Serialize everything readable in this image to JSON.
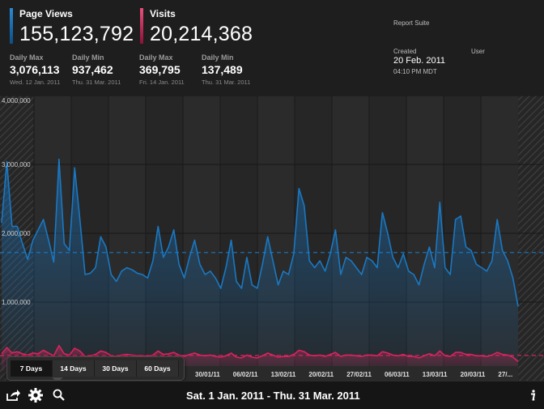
{
  "header": {
    "page_views": {
      "label": "Page Views",
      "value": "155,123,792",
      "color": "#1a78c2"
    },
    "visits": {
      "label": "Visits",
      "value": "20,214,368",
      "color": "#d8245e"
    },
    "pv_daily_max": {
      "label": "Daily Max",
      "value": "3,076,113",
      "date": "Wed. 12 Jan. 2011"
    },
    "pv_daily_min": {
      "label": "Daily Min",
      "value": "937,462",
      "date": "Thu. 31 Mar. 2011"
    },
    "v_daily_max": {
      "label": "Daily Max",
      "value": "369,795",
      "date": "Fri. 14 Jan. 2011"
    },
    "v_daily_min": {
      "label": "Daily Min",
      "value": "137,489",
      "date": "Thu. 31 Mar. 2011"
    },
    "report_suite_label": "Report Suite",
    "created_label": "Created",
    "created_date": "20 Feb. 2011",
    "created_time": "04:10 PM MDT",
    "user_label": "User"
  },
  "range_picker": {
    "options": [
      "7 Days",
      "14 Days",
      "30 Days",
      "60 Days"
    ],
    "selected": "7 Days"
  },
  "footer": {
    "date_range": "Sat.  1 Jan. 2011   -   Thu. 31 Mar. 2011"
  },
  "chart_data": {
    "type": "line",
    "x_tick_labels": [
      "30/01/11",
      "06/02/11",
      "13/02/11",
      "20/02/11",
      "27/02/11",
      "06/03/11",
      "13/03/11",
      "20/03/11",
      "27/..."
    ],
    "y_tick_labels": [
      "4,000,000",
      "3,000,000",
      "2,000,000",
      "1,000,000"
    ],
    "ylim": [
      0,
      4000000
    ],
    "grid": true,
    "series": [
      {
        "name": "Page Views",
        "color": "#1a78c2",
        "average": 1720000,
        "values": [
          2150000,
          3040000,
          2100000,
          2100000,
          1850000,
          1620000,
          1900000,
          2050000,
          2200000,
          1900000,
          1580000,
          3076113,
          1850000,
          1750000,
          2950000,
          2200000,
          1400000,
          1420000,
          1500000,
          1950000,
          1800000,
          1400000,
          1300000,
          1450000,
          1500000,
          1470000,
          1420000,
          1400000,
          1350000,
          1600000,
          2100000,
          1650000,
          1800000,
          2050000,
          1550000,
          1350000,
          1650000,
          1900000,
          1550000,
          1400000,
          1450000,
          1350000,
          1200000,
          1500000,
          1900000,
          1300000,
          1200000,
          1650000,
          1250000,
          1200000,
          1550000,
          1950000,
          1600000,
          1250000,
          1450000,
          1400000,
          1700000,
          2650000,
          2400000,
          1600000,
          1500000,
          1600000,
          1450000,
          1700000,
          2050000,
          1400000,
          1650000,
          1600000,
          1500000,
          1400000,
          1650000,
          1600000,
          1500000,
          2300000,
          2000000,
          1650000,
          1500000,
          1700000,
          1450000,
          1400000,
          1250000,
          1550000,
          1800000,
          1500000,
          2450000,
          1500000,
          1400000,
          2200000,
          2250000,
          1800000,
          1750000,
          1550000,
          1500000,
          1450000,
          1600000,
          2200000,
          1750000,
          1600000,
          1350000,
          937462
        ]
      },
      {
        "name": "Visits",
        "color": "#d8245e",
        "average": 225000,
        "values": [
          250000,
          340000,
          260000,
          280000,
          250000,
          230000,
          260000,
          250000,
          300000,
          260000,
          220000,
          369795,
          250000,
          230000,
          330000,
          290000,
          210000,
          220000,
          240000,
          290000,
          270000,
          220000,
          210000,
          230000,
          240000,
          230000,
          220000,
          220000,
          210000,
          230000,
          290000,
          240000,
          250000,
          270000,
          230000,
          210000,
          240000,
          260000,
          230000,
          220000,
          230000,
          210000,
          200000,
          220000,
          260000,
          200000,
          190000,
          230000,
          200000,
          190000,
          220000,
          260000,
          230000,
          200000,
          210000,
          210000,
          240000,
          300000,
          280000,
          230000,
          220000,
          230000,
          210000,
          240000,
          270000,
          210000,
          230000,
          230000,
          220000,
          210000,
          230000,
          230000,
          220000,
          280000,
          260000,
          230000,
          220000,
          240000,
          210000,
          210000,
          190000,
          220000,
          250000,
          220000,
          290000,
          220000,
          210000,
          270000,
          270000,
          240000,
          240000,
          220000,
          220000,
          210000,
          230000,
          270000,
          240000,
          230000,
          200000,
          137489
        ]
      }
    ]
  }
}
